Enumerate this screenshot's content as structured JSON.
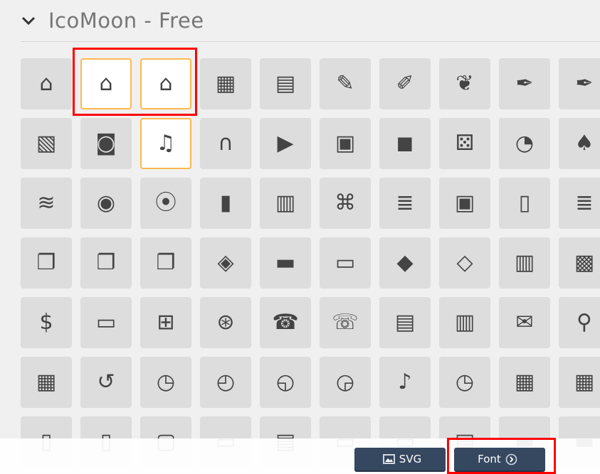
{
  "section": {
    "title": "IcoMoon - Free",
    "collapse_icon": "chevron-down-icon"
  },
  "icons": [
    {
      "name": "home",
      "g": "⌂"
    },
    {
      "name": "home2",
      "g": "⌂"
    },
    {
      "name": "home3",
      "g": "⌂"
    },
    {
      "name": "office",
      "g": "▦"
    },
    {
      "name": "newspaper",
      "g": "▤"
    },
    {
      "name": "pencil",
      "g": "✎"
    },
    {
      "name": "pencil2",
      "g": "✐"
    },
    {
      "name": "quill",
      "g": "❦"
    },
    {
      "name": "pen",
      "g": "✒"
    },
    {
      "name": "blog",
      "g": "✒"
    },
    {
      "name": "images",
      "g": "▧"
    },
    {
      "name": "camera",
      "g": "◙"
    },
    {
      "name": "music",
      "g": "♫"
    },
    {
      "name": "headphones",
      "g": "∩"
    },
    {
      "name": "play",
      "g": "▶"
    },
    {
      "name": "film",
      "g": "▣"
    },
    {
      "name": "video-camera",
      "g": "◼"
    },
    {
      "name": "dice",
      "g": "⚄"
    },
    {
      "name": "pacman",
      "g": "◔"
    },
    {
      "name": "spades",
      "g": "♠"
    },
    {
      "name": "connection",
      "g": "≋"
    },
    {
      "name": "podcast",
      "g": "◉"
    },
    {
      "name": "feed",
      "g": "⦿"
    },
    {
      "name": "book",
      "g": "▮"
    },
    {
      "name": "books",
      "g": "▥"
    },
    {
      "name": "library",
      "g": "⌘"
    },
    {
      "name": "file-text",
      "g": "≣"
    },
    {
      "name": "profile",
      "g": "▣"
    },
    {
      "name": "file-empty",
      "g": "▯"
    },
    {
      "name": "file-text2",
      "g": "≣"
    },
    {
      "name": "copy",
      "g": "❐"
    },
    {
      "name": "paste",
      "g": "❐"
    },
    {
      "name": "paste2",
      "g": "❐"
    },
    {
      "name": "stack",
      "g": "◈"
    },
    {
      "name": "folder",
      "g": "▬"
    },
    {
      "name": "folder-open",
      "g": "▭"
    },
    {
      "name": "price-tag",
      "g": "◆"
    },
    {
      "name": "price-tags",
      "g": "◇"
    },
    {
      "name": "barcode",
      "g": "▥"
    },
    {
      "name": "qrcode",
      "g": "▩"
    },
    {
      "name": "coin-dollar",
      "g": "$"
    },
    {
      "name": "credit-card",
      "g": "▭"
    },
    {
      "name": "calculator",
      "g": "⊞"
    },
    {
      "name": "lifebuoy",
      "g": "⊛"
    },
    {
      "name": "phone",
      "g": "☎"
    },
    {
      "name": "phone-hang-up",
      "g": "☏"
    },
    {
      "name": "address-book",
      "g": "▤"
    },
    {
      "name": "notebook",
      "g": "▥"
    },
    {
      "name": "envelop",
      "g": "✉"
    },
    {
      "name": "pushpin",
      "g": "⚲"
    },
    {
      "name": "map",
      "g": "▦"
    },
    {
      "name": "history",
      "g": "↺"
    },
    {
      "name": "clock",
      "g": "◷"
    },
    {
      "name": "clock2",
      "g": "◴"
    },
    {
      "name": "alarm",
      "g": "◵"
    },
    {
      "name": "alarm2",
      "g": "◶"
    },
    {
      "name": "bell",
      "g": "♪"
    },
    {
      "name": "stopwatch",
      "g": "◷"
    },
    {
      "name": "calendar",
      "g": "▦"
    },
    {
      "name": "calendar2",
      "g": "▦"
    },
    {
      "name": "mobile",
      "g": "▯"
    },
    {
      "name": "tablet",
      "g": "▯"
    },
    {
      "name": "tablet2",
      "g": "▢"
    },
    {
      "name": "tv",
      "g": "▭"
    },
    {
      "name": "cabinet",
      "g": "▤"
    },
    {
      "name": "drawer",
      "g": "▭"
    },
    {
      "name": "drawer2",
      "g": "▭"
    },
    {
      "name": "box-add",
      "g": "▤"
    },
    {
      "name": "box-remove",
      "g": "▬"
    },
    {
      "name": "upload",
      "g": "▬"
    }
  ],
  "selected": [
    1,
    2,
    12
  ],
  "buttons": {
    "svg_label": "SVG",
    "font_label": "Font"
  },
  "colors": {
    "selected_border": "#ffb84d",
    "button": "#364860",
    "highlight": "#ff0000"
  }
}
